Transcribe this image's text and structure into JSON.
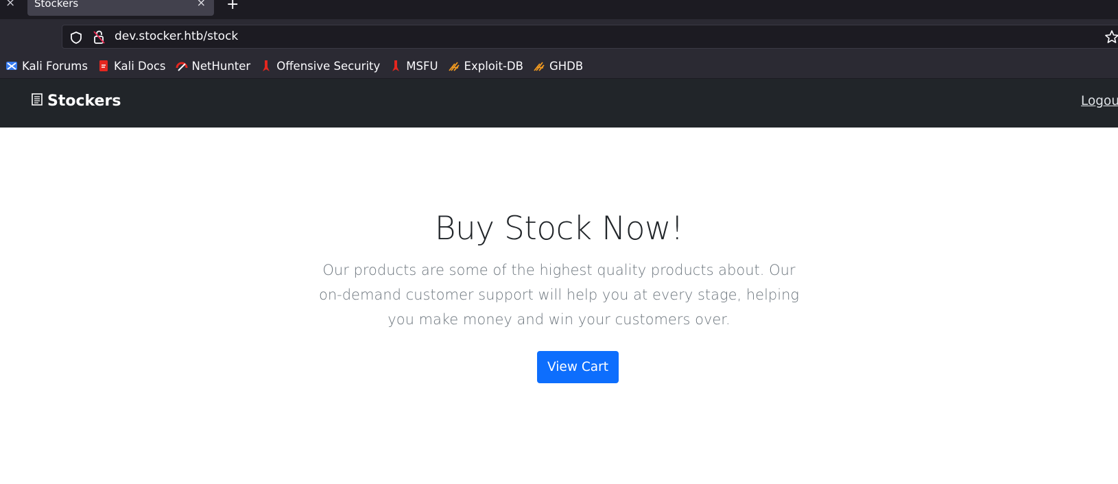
{
  "browser": {
    "tab_title": "Stockers",
    "tab_close": "×",
    "prev_tab_close": "×",
    "new_tab": "+",
    "url": "dev.stocker.htb/stock"
  },
  "bookmarks": [
    {
      "label": "Kali Forums",
      "icon": "kali-forums-icon",
      "color": "#367bf0"
    },
    {
      "label": "Kali Docs",
      "icon": "kali-docs-icon",
      "color": "#e5261f"
    },
    {
      "label": "NetHunter",
      "icon": "nethunter-icon",
      "color": "#e5261f"
    },
    {
      "label": "Offensive Security",
      "icon": "offsec-icon",
      "color": "#e5261f"
    },
    {
      "label": "MSFU",
      "icon": "msfu-icon",
      "color": "#e5261f"
    },
    {
      "label": "Exploit-DB",
      "icon": "exploitdb-icon",
      "color": "#f29a1f"
    },
    {
      "label": "GHDB",
      "icon": "ghdb-icon",
      "color": "#f29a1f"
    }
  ],
  "site": {
    "brand": "Stockers",
    "logout": "Logout"
  },
  "hero": {
    "title": "Buy Stock Now!",
    "text": "Our products are some of the highest quality products about. Our on-demand customer support will help you at every stage, helping you make money and win your customers over.",
    "button": "View Cart",
    "button_color": "#0d6efd"
  }
}
